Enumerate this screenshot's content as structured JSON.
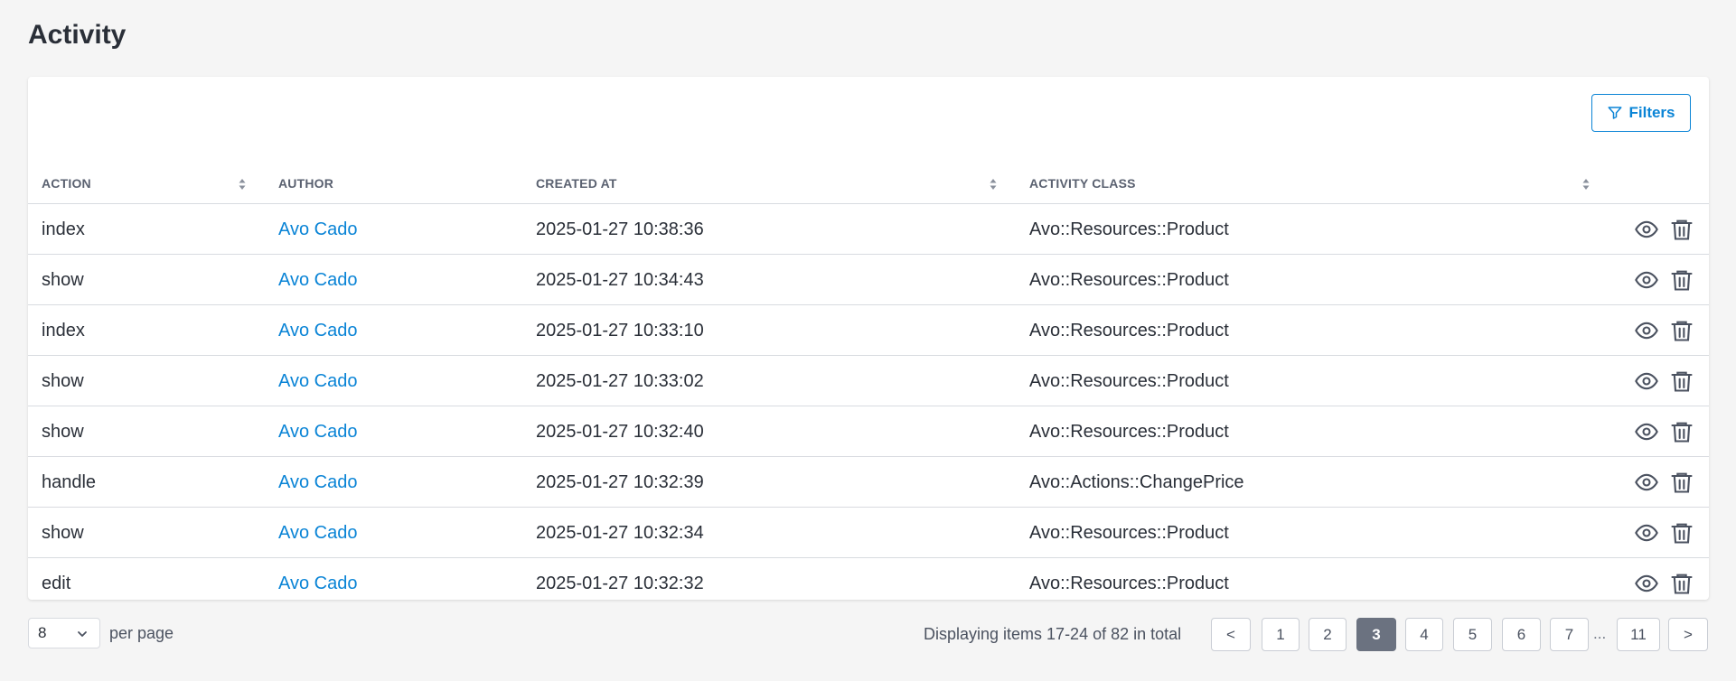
{
  "page": {
    "title": "Activity"
  },
  "toolbar": {
    "filters_label": "Filters"
  },
  "table": {
    "columns": {
      "action": "ACTION",
      "author": "AUTHOR",
      "created_at": "CREATED AT",
      "activity_class": "ACTIVITY CLASS"
    },
    "rows": [
      {
        "action": "index",
        "author": "Avo Cado",
        "created_at": "2025-01-27 10:38:36",
        "activity_class": "Avo::Resources::Product"
      },
      {
        "action": "show",
        "author": "Avo Cado",
        "created_at": "2025-01-27 10:34:43",
        "activity_class": "Avo::Resources::Product"
      },
      {
        "action": "index",
        "author": "Avo Cado",
        "created_at": "2025-01-27 10:33:10",
        "activity_class": "Avo::Resources::Product"
      },
      {
        "action": "show",
        "author": "Avo Cado",
        "created_at": "2025-01-27 10:33:02",
        "activity_class": "Avo::Resources::Product"
      },
      {
        "action": "show",
        "author": "Avo Cado",
        "created_at": "2025-01-27 10:32:40",
        "activity_class": "Avo::Resources::Product"
      },
      {
        "action": "handle",
        "author": "Avo Cado",
        "created_at": "2025-01-27 10:32:39",
        "activity_class": "Avo::Actions::ChangePrice"
      },
      {
        "action": "show",
        "author": "Avo Cado",
        "created_at": "2025-01-27 10:32:34",
        "activity_class": "Avo::Resources::Product"
      },
      {
        "action": "edit",
        "author": "Avo Cado",
        "created_at": "2025-01-27 10:32:32",
        "activity_class": "Avo::Resources::Product"
      }
    ],
    "row_action_icons": [
      "eye-icon",
      "trash-icon"
    ]
  },
  "pagination": {
    "per_page_value": "8",
    "per_page_label": "per page",
    "display_info": "Displaying items 17-24 of 82 in total",
    "prev_label": "<",
    "next_label": ">",
    "pages": [
      "1",
      "2",
      "3",
      "4",
      "5",
      "6",
      "7"
    ],
    "ellipsis": "...",
    "last_page": "11",
    "current_page": "3"
  },
  "colors": {
    "accent": "#0a84d6",
    "background": "#f5f5f5",
    "active_page": "#6b7280"
  }
}
